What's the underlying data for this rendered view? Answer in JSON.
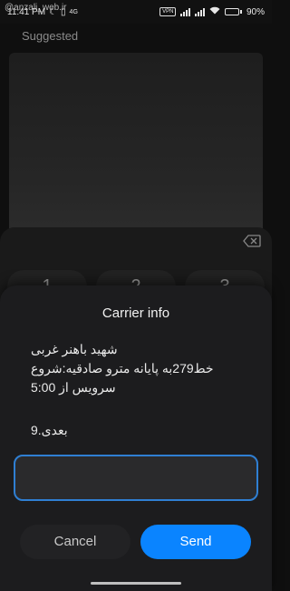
{
  "status_bar": {
    "time": "11:41 PM",
    "network_type": "4G",
    "vpn": "VPN",
    "battery_percent": "90%",
    "battery_level": 0.9
  },
  "watermark": "@anzali_web.ir",
  "background": {
    "suggested_label": "Suggested",
    "keypad_keys": [
      "1",
      "2",
      "3"
    ]
  },
  "dialog": {
    "title": "Carrier info",
    "message": "شهید باهنر غربی\nخط279به پایانه مترو صادقیه:شروع\nسرویس از 5:00",
    "next_label": "بعدی.9",
    "input": {
      "value": "",
      "placeholder": ""
    },
    "cancel_label": "Cancel",
    "send_label": "Send",
    "accent_color": "#0a84ff"
  }
}
